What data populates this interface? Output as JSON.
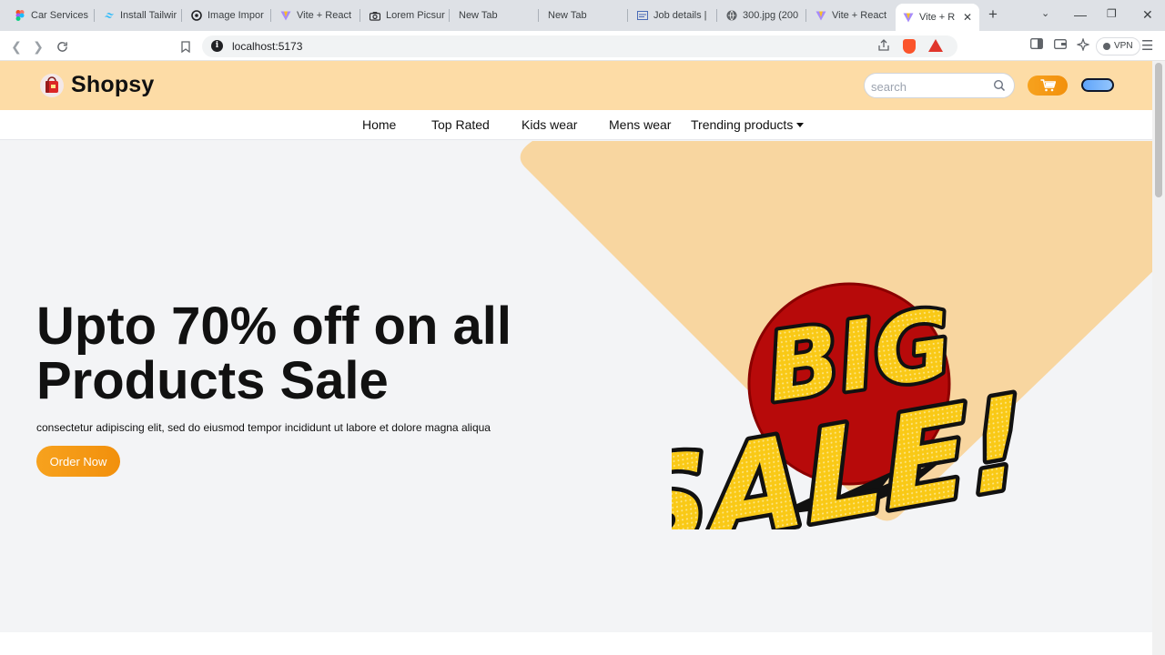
{
  "browser": {
    "tabs": [
      {
        "title": "Car Services",
        "icon": "figma-icon"
      },
      {
        "title": "Install Tailwir",
        "icon": "tailwind-icon"
      },
      {
        "title": "Image Impor",
        "icon": "openai-icon"
      },
      {
        "title": "Vite + React",
        "icon": "vite-icon"
      },
      {
        "title": "Lorem Picsur",
        "icon": "camera-icon"
      },
      {
        "title": "New Tab",
        "icon": ""
      },
      {
        "title": "New Tab",
        "icon": ""
      },
      {
        "title": "Job details |",
        "icon": "doc-icon"
      },
      {
        "title": "300.jpg (200",
        "icon": "globe-icon"
      },
      {
        "title": "Vite + React",
        "icon": "vite-icon"
      },
      {
        "title": "Vite + R",
        "icon": "vite-icon"
      }
    ],
    "url": "localhost:5173",
    "vpn_label": "VPN"
  },
  "site": {
    "brand": "Shopsy",
    "search_placeholder": "search",
    "menu": [
      "Home",
      "Top Rated",
      "Kids wear",
      "Mens wear",
      "Trending products"
    ],
    "hero": {
      "title_line1": "Upto 70% off on all",
      "title_line2": "Products Sale",
      "subtitle": "consectetur adipiscing elit, sed do eiusmod tempor incididunt ut labore et dolore magna aliqua",
      "cta": "Order Now",
      "image_text_1": "BIG",
      "image_text_2": "SALE!"
    }
  },
  "colors": {
    "header_bg": "#fddca6",
    "accent": "#f59e0b",
    "hero_bg": "#f3f4f6",
    "sale_yellow": "#f9c916",
    "sale_red": "#b70a0a"
  }
}
